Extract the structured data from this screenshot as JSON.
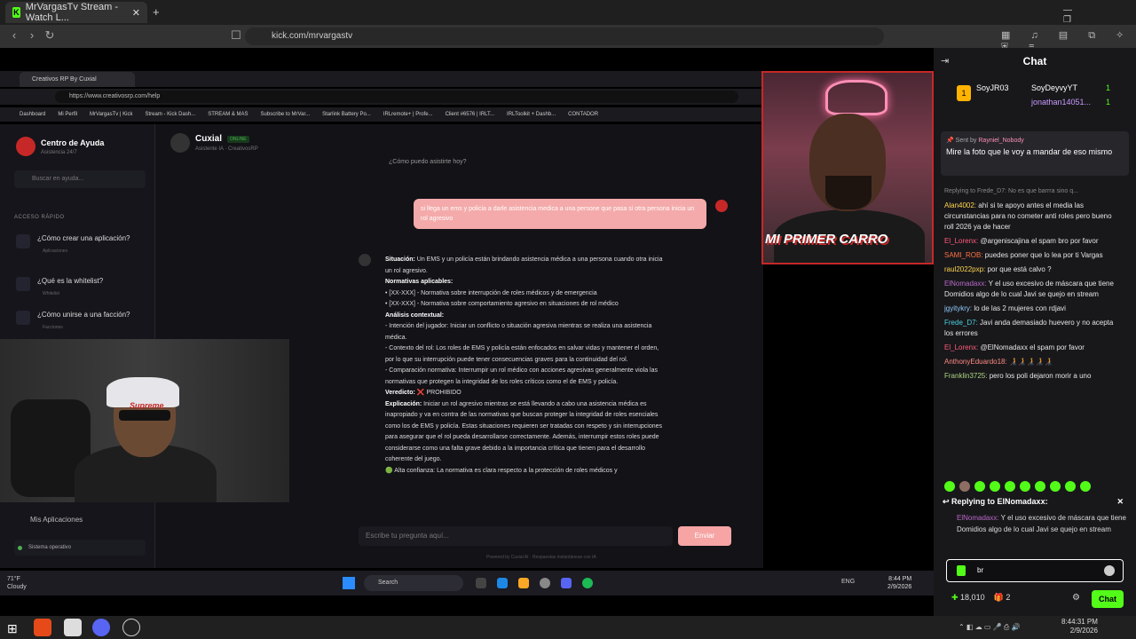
{
  "browser": {
    "tab_title": "MrVargasTv Stream - Watch L...",
    "url": "kick.com/mrvargastv"
  },
  "inner_browser": {
    "tab_title": "Creativos RP By Cuxial",
    "url": "https://www.creativosrp.com/help",
    "bookmarks": [
      "Dashboard",
      "Mi Perfil",
      "MrVargasTv | Kick",
      "Stream - Kick Dash...",
      "STREAM & MAS",
      "Subscribe to MrVar...",
      "Starlink Battery Po...",
      "IRLremote+ | Profe...",
      "Client #6576 | IRLT...",
      "IRLToolkit + Dashb...",
      "CONTADOR"
    ]
  },
  "site": {
    "sidebar_title": "Centro de Ayuda",
    "sidebar_subtitle": "Asistencia 24/7",
    "search_placeholder": "Buscar en ayuda...",
    "quick_label": "ACCESO RÁPIDO",
    "quick_items": [
      {
        "label": "¿Cómo crear una aplicación?",
        "sub": "Aplicaciones"
      },
      {
        "label": "¿Qué es la whitelist?",
        "sub": "Whitelist"
      },
      {
        "label": "¿Cómo unirse a una facción?",
        "sub": "Facciones"
      }
    ],
    "my_apps": "Mis Aplicaciones",
    "status": "Sistema operativo",
    "assistant_name": "Cuxial",
    "online_badge": "ONLINE",
    "assistant_sub": "Asistente IA · CreativosRP",
    "prev_question": "¿Cómo puedo asistirte hoy?",
    "user_msg": "si llega un ems y policia a darle asistencia medica a una persone que pasa si otra persona inicia un rol agresivo",
    "bot_lines": [
      {
        "bold": "Situación:",
        "text": " Un EMS y un policía están brindando asistencia médica a una persona cuando otra inicia un rol agresivo."
      },
      {
        "bold": "Normativas aplicables:",
        "text": ""
      },
      {
        "bold": "",
        "text": "• [XX-XXX] - Normativa sobre interrupción de roles médicos y de emergencia"
      },
      {
        "bold": "",
        "text": "• [XX-XXX] - Normativa sobre comportamiento agresivo en situaciones de rol médico"
      },
      {
        "bold": "Análisis contextual:",
        "text": ""
      },
      {
        "bold": "",
        "text": "- Intención del jugador: Iniciar un conflicto o situación agresiva mientras se realiza una asistencia médica."
      },
      {
        "bold": "",
        "text": "- Contexto del rol: Los roles de EMS y policía están enfocados en salvar vidas y mantener el orden, por lo que su interrupción puede tener consecuencias graves para la continuidad del rol."
      },
      {
        "bold": "",
        "text": "- Comparación normativa: Interrumpir un rol médico con acciones agresivas generalmente viola las normativas que protegen la integridad de los roles críticos como el de EMS y policía."
      },
      {
        "bold": "Veredicto:",
        "text": " ❌ PROHIBIDO"
      },
      {
        "bold": "Explicación:",
        "text": " Iniciar un rol agresivo mientras se está llevando a cabo una asistencia médica es inapropiado y va en contra de las normativas que buscan proteger la integridad de roles esenciales como los de EMS y policía. Estas situaciones requieren ser tratadas con respeto y sin interrupciones para asegurar que el rol pueda desarrollarse correctamente. Además, interrumpir estos roles puede considerarse como una falta grave debido a la importancia crítica que tienen para el desarrollo coherente del juego."
      },
      {
        "bold": "",
        "text": "🟢 Alta confianza: La normativa es clara respecto a la protección de roles médicos y"
      }
    ],
    "input_placeholder": "Escribe tu pregunta aquí...",
    "send_label": "Enviar",
    "powered": "Powered by Cuxial AI · Respuestas instantáneas con IA"
  },
  "webcam": {
    "overlay_text": "MI PRIMER CARRO",
    "cap_label": "Supreme"
  },
  "inner_taskbar": {
    "weather_temp": "71°F",
    "weather_desc": "Cloudy",
    "search": "Search",
    "lang": "ENG",
    "time": "8:44 PM",
    "date": "2/9/2026"
  },
  "chat": {
    "title": "Chat",
    "gifters": [
      {
        "rank": "1",
        "name": "SoyJR03"
      },
      {
        "name": "SoyDeyvyYT",
        "count": "1"
      },
      {
        "name": "jonathan14051...",
        "count": "1"
      }
    ],
    "pinned_sender_prefix": "Sent by",
    "pinned_sender": "Rayniel_Nobody",
    "pinned_text": "Mire la foto que le voy a mandar de eso mismo",
    "messages": [
      {
        "reply": "Replying to Frede_D7: No es que barrra sino q...",
        "user": "",
        "text": ""
      },
      {
        "user": "Alan4002:",
        "color": "#ffd54f",
        "text": " ahí si te apoyo antes el media las circunstancias para no cometer anti roles pero bueno roll 2026 ya de hacer"
      },
      {
        "user": "El_Lorenx:",
        "color": "#ff5a7a",
        "text": " @argeniscajina el spam bro por favor"
      },
      {
        "user": "SAMI_ROB:",
        "color": "#ff7043",
        "text": " puedes poner que lo lea por ti Vargas"
      },
      {
        "user": "raul2022pxp:",
        "color": "#ffd54f",
        "text": " por que está calvo ?"
      },
      {
        "user": "ElNomadaxx:",
        "color": "#ba68c8",
        "text": " Y el uso excesivo de máscara que tiene Domidios algo de lo cual Javi se quejo en stream"
      },
      {
        "user": "jgyitykry:",
        "color": "#90caf9",
        "text": " lo de las 2 mujeres con rdjavi"
      },
      {
        "user": "Frede_D7:",
        "color": "#4dd0e1",
        "text": " Javi anda demasiado huevero y no acepta los errores"
      },
      {
        "user": "El_Lorenx:",
        "color": "#ff5a7a",
        "text": " @ElNomadaxx el spam por favor"
      },
      {
        "user": "AnthonyEduardo18:",
        "color": "#ff8a80",
        "text": " 🧑‍🦯🧑‍🦯🧑‍🦯🧑‍🦯🧑‍🦯"
      },
      {
        "user": "Franklin3725:",
        "color": "#aed581",
        "text": " pero los poli dejaron morir a uno"
      }
    ],
    "reply_title": "Replying to ElNomadaxx:",
    "reply_user": "ElNomadaxx:",
    "reply_text": " Y el uso excesivo de máscara que tiene Domidios algo de lo cual Javi se quejo en stream",
    "input_value": "br",
    "points": "18,010",
    "gift_count": "2",
    "send_label": "Chat"
  },
  "os": {
    "time": "8:44:31 PM",
    "date": "2/9/2026"
  },
  "colors": {
    "kick_green": "#53fc18",
    "accent_red": "#c62828",
    "user_bubble": "#f4aaaa"
  }
}
